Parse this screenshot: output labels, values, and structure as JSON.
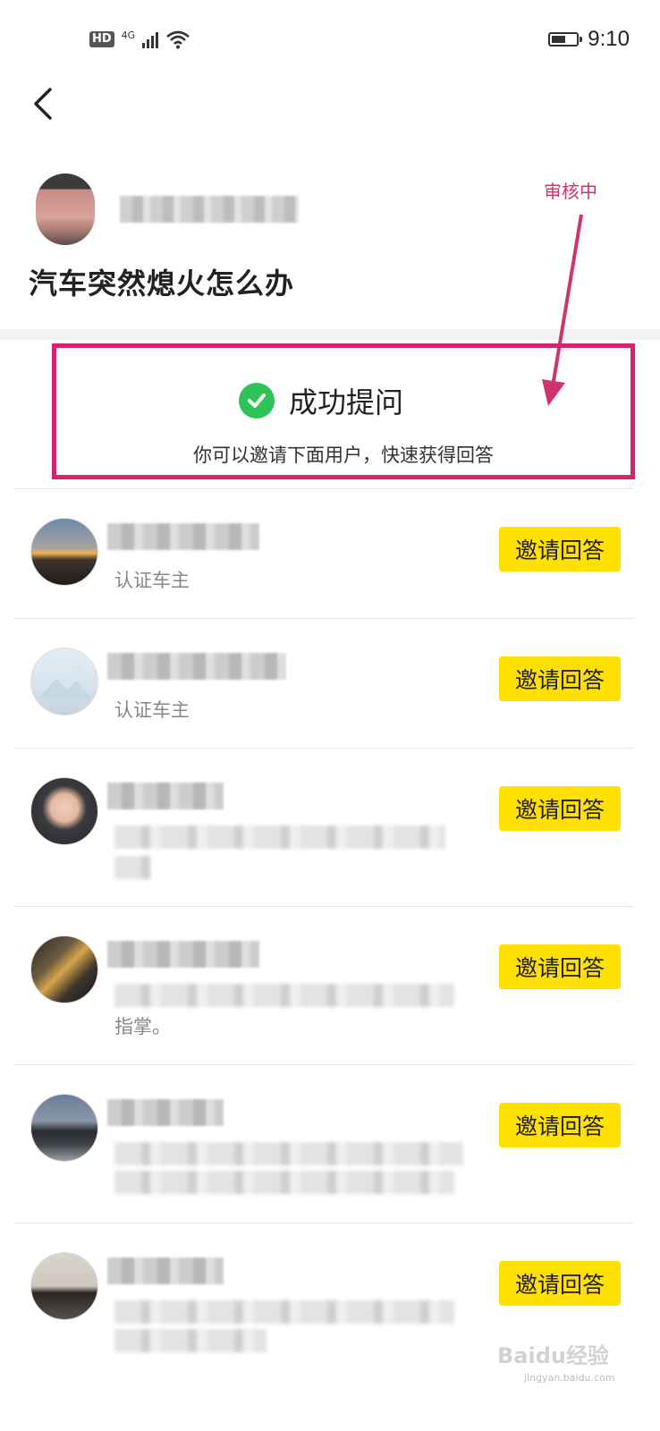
{
  "status_bar": {
    "hd_label": "HD",
    "network_label": "4G",
    "time": "9:10",
    "battery_level": 0.55
  },
  "nav": {
    "back_icon": "chevron-left-icon"
  },
  "question": {
    "title": "汽车突然熄火怎么办"
  },
  "annotation": {
    "label": "审核中",
    "color": "#d0346e"
  },
  "success": {
    "title": "成功提问",
    "subtitle": "你可以邀请下面用户，快速获得回答",
    "icon": "check-circle-icon",
    "icon_color": "#2fc45a",
    "highlight_border_color": "#d2246f"
  },
  "invite_button_color": "#ffe000",
  "users": [
    {
      "desc": "认证车主",
      "invite_label": "邀请回答"
    },
    {
      "desc": "认证车主",
      "invite_label": "邀请回答"
    },
    {
      "desc": "",
      "invite_label": "邀请回答"
    },
    {
      "desc": "指掌。",
      "invite_label": "邀请回答"
    },
    {
      "desc": "",
      "invite_label": "邀请回答"
    },
    {
      "desc": "",
      "invite_label": "邀请回答"
    }
  ],
  "watermark": {
    "text": "Baidu经验",
    "sub": "jingyan.baidu.com"
  }
}
